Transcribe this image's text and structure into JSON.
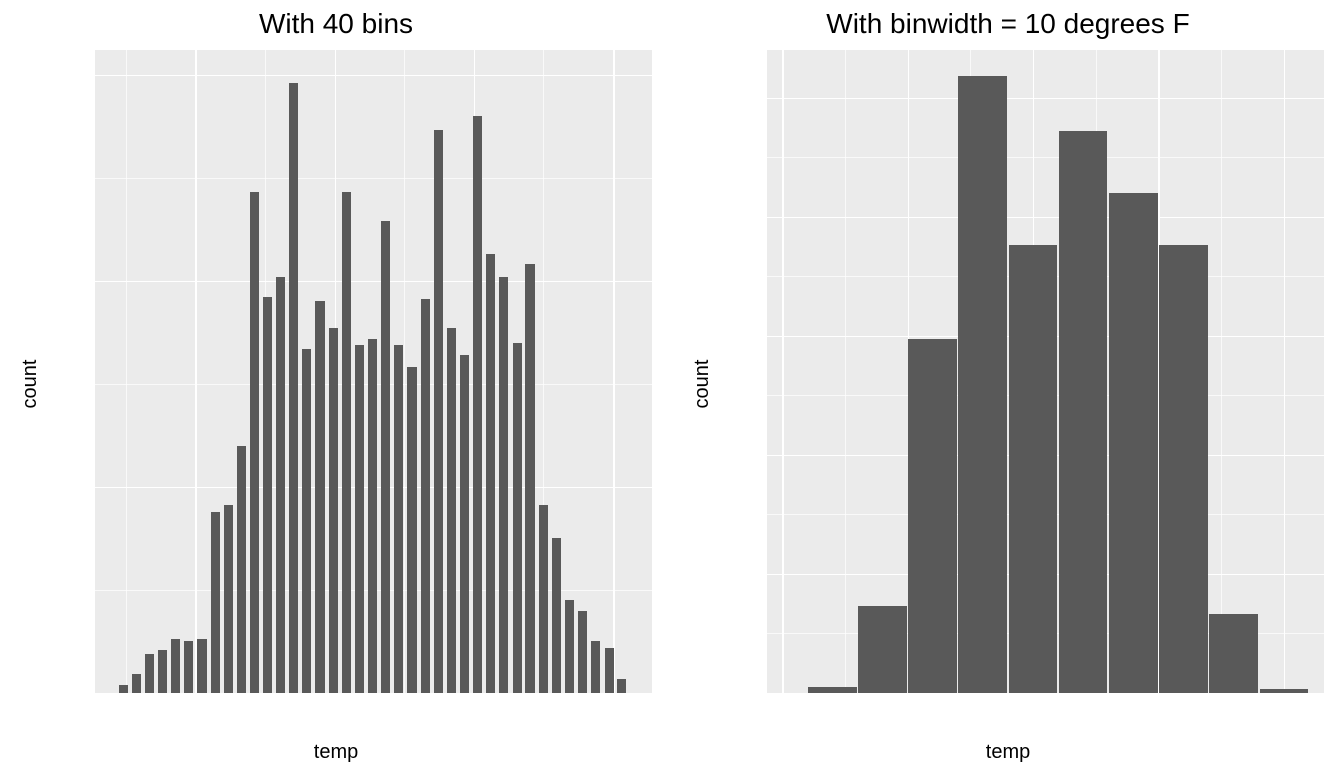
{
  "chart_data": [
    {
      "type": "bar",
      "title": "With 40 bins",
      "xlabel": "temp",
      "ylabel": "count",
      "xlim": [
        7,
        107
      ],
      "ylim": [
        0,
        1560
      ],
      "xticks": [
        25,
        50,
        75,
        100
      ],
      "yticks": [
        0,
        500,
        1000,
        1500
      ],
      "xminor": [
        12.5,
        37.5,
        62.5,
        87.5
      ],
      "yminor": [
        250,
        750,
        1250
      ],
      "bin_width": 2.35,
      "bar_gap_frac": 0.3,
      "centers": [
        12.1,
        14.4,
        16.8,
        19.1,
        21.5,
        23.8,
        26.2,
        28.6,
        30.9,
        33.3,
        35.6,
        38.0,
        40.3,
        42.7,
        45.0,
        47.4,
        49.8,
        52.1,
        54.5,
        56.8,
        59.2,
        61.5,
        63.9,
        66.3,
        68.6,
        71.0,
        73.3,
        75.7,
        78.0,
        80.4,
        82.8,
        85.1,
        87.5,
        89.8,
        92.2,
        94.5,
        96.9,
        99.3,
        101.6
      ],
      "values": [
        20,
        45,
        95,
        105,
        130,
        125,
        130,
        440,
        455,
        600,
        1215,
        960,
        1010,
        1480,
        835,
        950,
        885,
        1215,
        845,
        860,
        1145,
        845,
        790,
        955,
        1365,
        885,
        820,
        1400,
        1065,
        1010,
        850,
        1040,
        455,
        375,
        225,
        200,
        125,
        110,
        35
      ]
    },
    {
      "type": "bar",
      "title": "With binwidth = 10 degrees F",
      "xlabel": "temp",
      "ylabel": "count",
      "xlim": [
        -3,
        108
      ],
      "ylim": [
        0,
        5400
      ],
      "xticks": [
        0,
        25,
        50,
        75,
        100
      ],
      "yticks": [
        0,
        1000,
        2000,
        3000,
        4000,
        5000
      ],
      "xminor": [
        12.5,
        37.5,
        62.5,
        87.5
      ],
      "yminor": [
        500,
        1500,
        2500,
        3500,
        4500
      ],
      "bin_width": 10,
      "bar_gap_frac": 0.03,
      "centers": [
        10,
        20,
        30,
        40,
        50,
        60,
        70,
        80,
        90,
        100
      ],
      "values": [
        50,
        730,
        2970,
        5180,
        3760,
        4720,
        4200,
        3760,
        660,
        30
      ]
    }
  ]
}
